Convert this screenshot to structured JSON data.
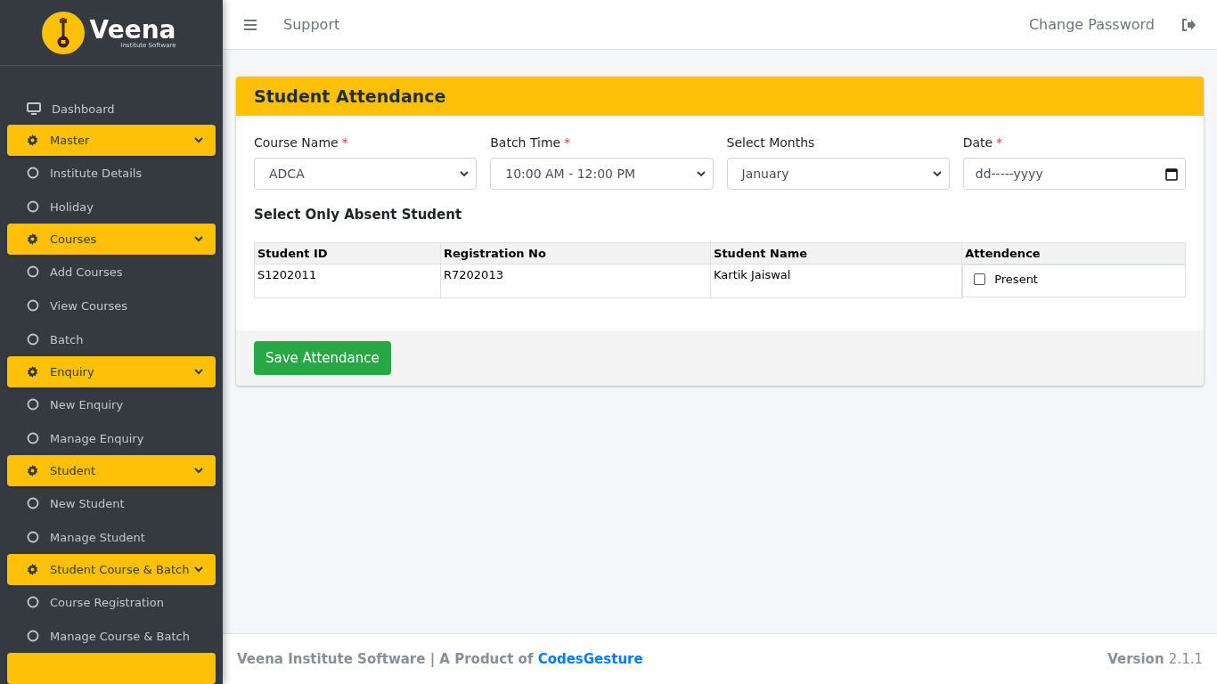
{
  "brand": {
    "name": "Veena",
    "tagline": "Institute Software"
  },
  "sidebar": {
    "items": [
      {
        "kind": "dashboard",
        "label": "Dashboard"
      },
      {
        "kind": "header",
        "label": "Master"
      },
      {
        "kind": "link",
        "label": "Institute Details"
      },
      {
        "kind": "link",
        "label": "Holiday"
      },
      {
        "kind": "header",
        "label": "Courses"
      },
      {
        "kind": "link",
        "label": "Add Courses"
      },
      {
        "kind": "link",
        "label": "View Courses"
      },
      {
        "kind": "link",
        "label": "Batch"
      },
      {
        "kind": "header",
        "label": "Enquiry"
      },
      {
        "kind": "link",
        "label": "New Enquiry"
      },
      {
        "kind": "link",
        "label": "Manage Enquiry"
      },
      {
        "kind": "header",
        "label": "Student"
      },
      {
        "kind": "link",
        "label": "New Student"
      },
      {
        "kind": "link",
        "label": "Manage Student"
      },
      {
        "kind": "header",
        "label": "Student Course & Batch"
      },
      {
        "kind": "link",
        "label": "Course Registration"
      },
      {
        "kind": "link",
        "label": "Manage Course & Batch"
      },
      {
        "kind": "header"
      }
    ]
  },
  "topbar": {
    "support": "Support",
    "change_password": "Change Password"
  },
  "card": {
    "title": "Student Attendance",
    "fields": [
      {
        "kind": "select",
        "label": "Course Name",
        "required_mark": "*",
        "value": "ADCA"
      },
      {
        "kind": "select",
        "label": "Batch Time",
        "required_mark": "*",
        "value": "10:00 AM - 12:00 PM"
      },
      {
        "kind": "select",
        "label": "Select Months",
        "value": "January"
      },
      {
        "kind": "date",
        "label": "Date",
        "required_mark": "*",
        "placeholder": "dd-----yyyy"
      }
    ],
    "subtitle": "Select Only Absent Student",
    "table": {
      "columns": [
        "Student ID",
        "Registration No",
        "Student Name",
        "Attendence"
      ],
      "rows": [
        {
          "student_id": "S1202011",
          "registration_no": "R7202013",
          "student_name": "Kartik Jaiswal",
          "attendance_label": "Present",
          "checked": false
        }
      ]
    },
    "save_button": "Save Attendance"
  },
  "footer": {
    "text": "Veena Institute Software | A Product of ",
    "link": "CodesGesture",
    "version_label": "Version",
    "version": "2.1.1"
  }
}
